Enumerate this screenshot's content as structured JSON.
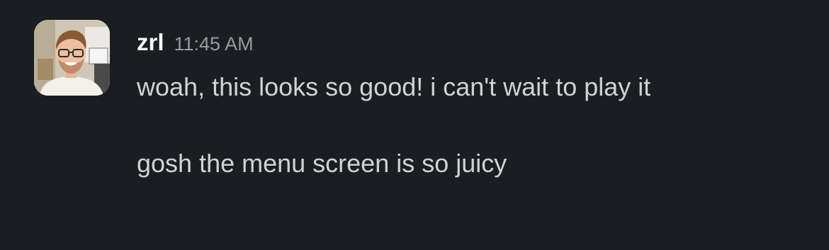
{
  "message": {
    "username": "zrl",
    "timestamp": "11:45 AM",
    "paragraphs": [
      "woah, this looks so good! i can't wait to play it",
      "gosh the menu screen is so juicy"
    ]
  },
  "colors": {
    "background": "#1a1d21",
    "username": "#f8f8f8",
    "timestamp": "#9a9b9d",
    "text": "#d1d2d3"
  },
  "avatar": {
    "icon": "user-avatar-photo"
  }
}
